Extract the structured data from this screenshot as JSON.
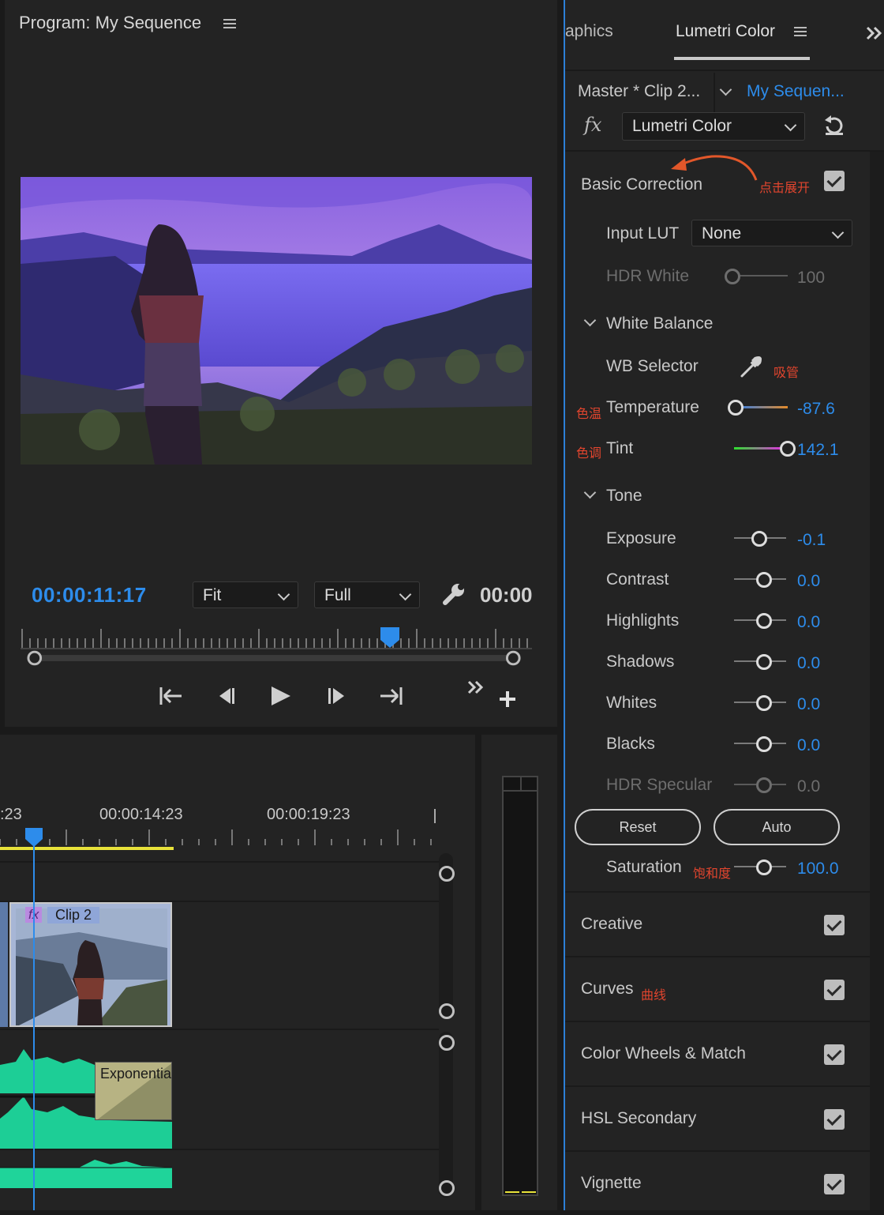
{
  "program_monitor": {
    "title": "Program: My Sequence",
    "timecode": "00:00:11:17",
    "timecode_right": "00:00",
    "zoom": "Fit",
    "resolution": "Full",
    "playhead_fraction": 0.72
  },
  "timeline": {
    "ruler_left": ":23",
    "ruler_mid": "00:00:14:23",
    "ruler_right": "00:00:19:23",
    "clip_name": "Clip 2",
    "fx_badge": "fx",
    "transition_label": "Exponentia"
  },
  "lumetri": {
    "tab_partial": "aphics",
    "tab_active": "Lumetri Color",
    "master_label": "Master * Clip 2...",
    "sequence_label": "My Sequen...",
    "fx_symbol": "fx",
    "effect_dropdown": "Lumetri Color",
    "basic_correction": "Basic Correction",
    "annotation_expand": "点击展开",
    "input_lut_label": "Input LUT",
    "input_lut_value": "None",
    "hdr_white_label": "HDR White",
    "hdr_white_value": "100",
    "white_balance": "White Balance",
    "wb_selector": "WB Selector",
    "annotation_eyedropper": "吸管",
    "annotation_temperature": "色温",
    "temperature_label": "Temperature",
    "temperature_value": "-87.6",
    "annotation_tint": "色调",
    "tint_label": "Tint",
    "tint_value": "142.1",
    "tone": "Tone",
    "exposure_label": "Exposure",
    "exposure_value": "-0.1",
    "contrast_label": "Contrast",
    "contrast_value": "0.0",
    "highlights_label": "Highlights",
    "highlights_value": "0.0",
    "shadows_label": "Shadows",
    "shadows_value": "0.0",
    "whites_label": "Whites",
    "whites_value": "0.0",
    "blacks_label": "Blacks",
    "blacks_value": "0.0",
    "hdr_specular_label": "HDR Specular",
    "hdr_specular_value": "0.0",
    "reset_button": "Reset",
    "auto_button": "Auto",
    "saturation_label": "Saturation",
    "annotation_saturation": "饱和度",
    "saturation_value": "100.0",
    "sections": [
      {
        "label": "Creative",
        "note": ""
      },
      {
        "label": "Curves",
        "note": "曲线"
      },
      {
        "label": "Color Wheels & Match",
        "note": ""
      },
      {
        "label": "HSL Secondary",
        "note": ""
      },
      {
        "label": "Vignette",
        "note": ""
      }
    ]
  },
  "colors": {
    "accent_blue": "#2d8ceb",
    "annotation_red": "#e2452e",
    "audio_green": "#1fd49a",
    "work_area_yellow": "#e8e23a"
  }
}
